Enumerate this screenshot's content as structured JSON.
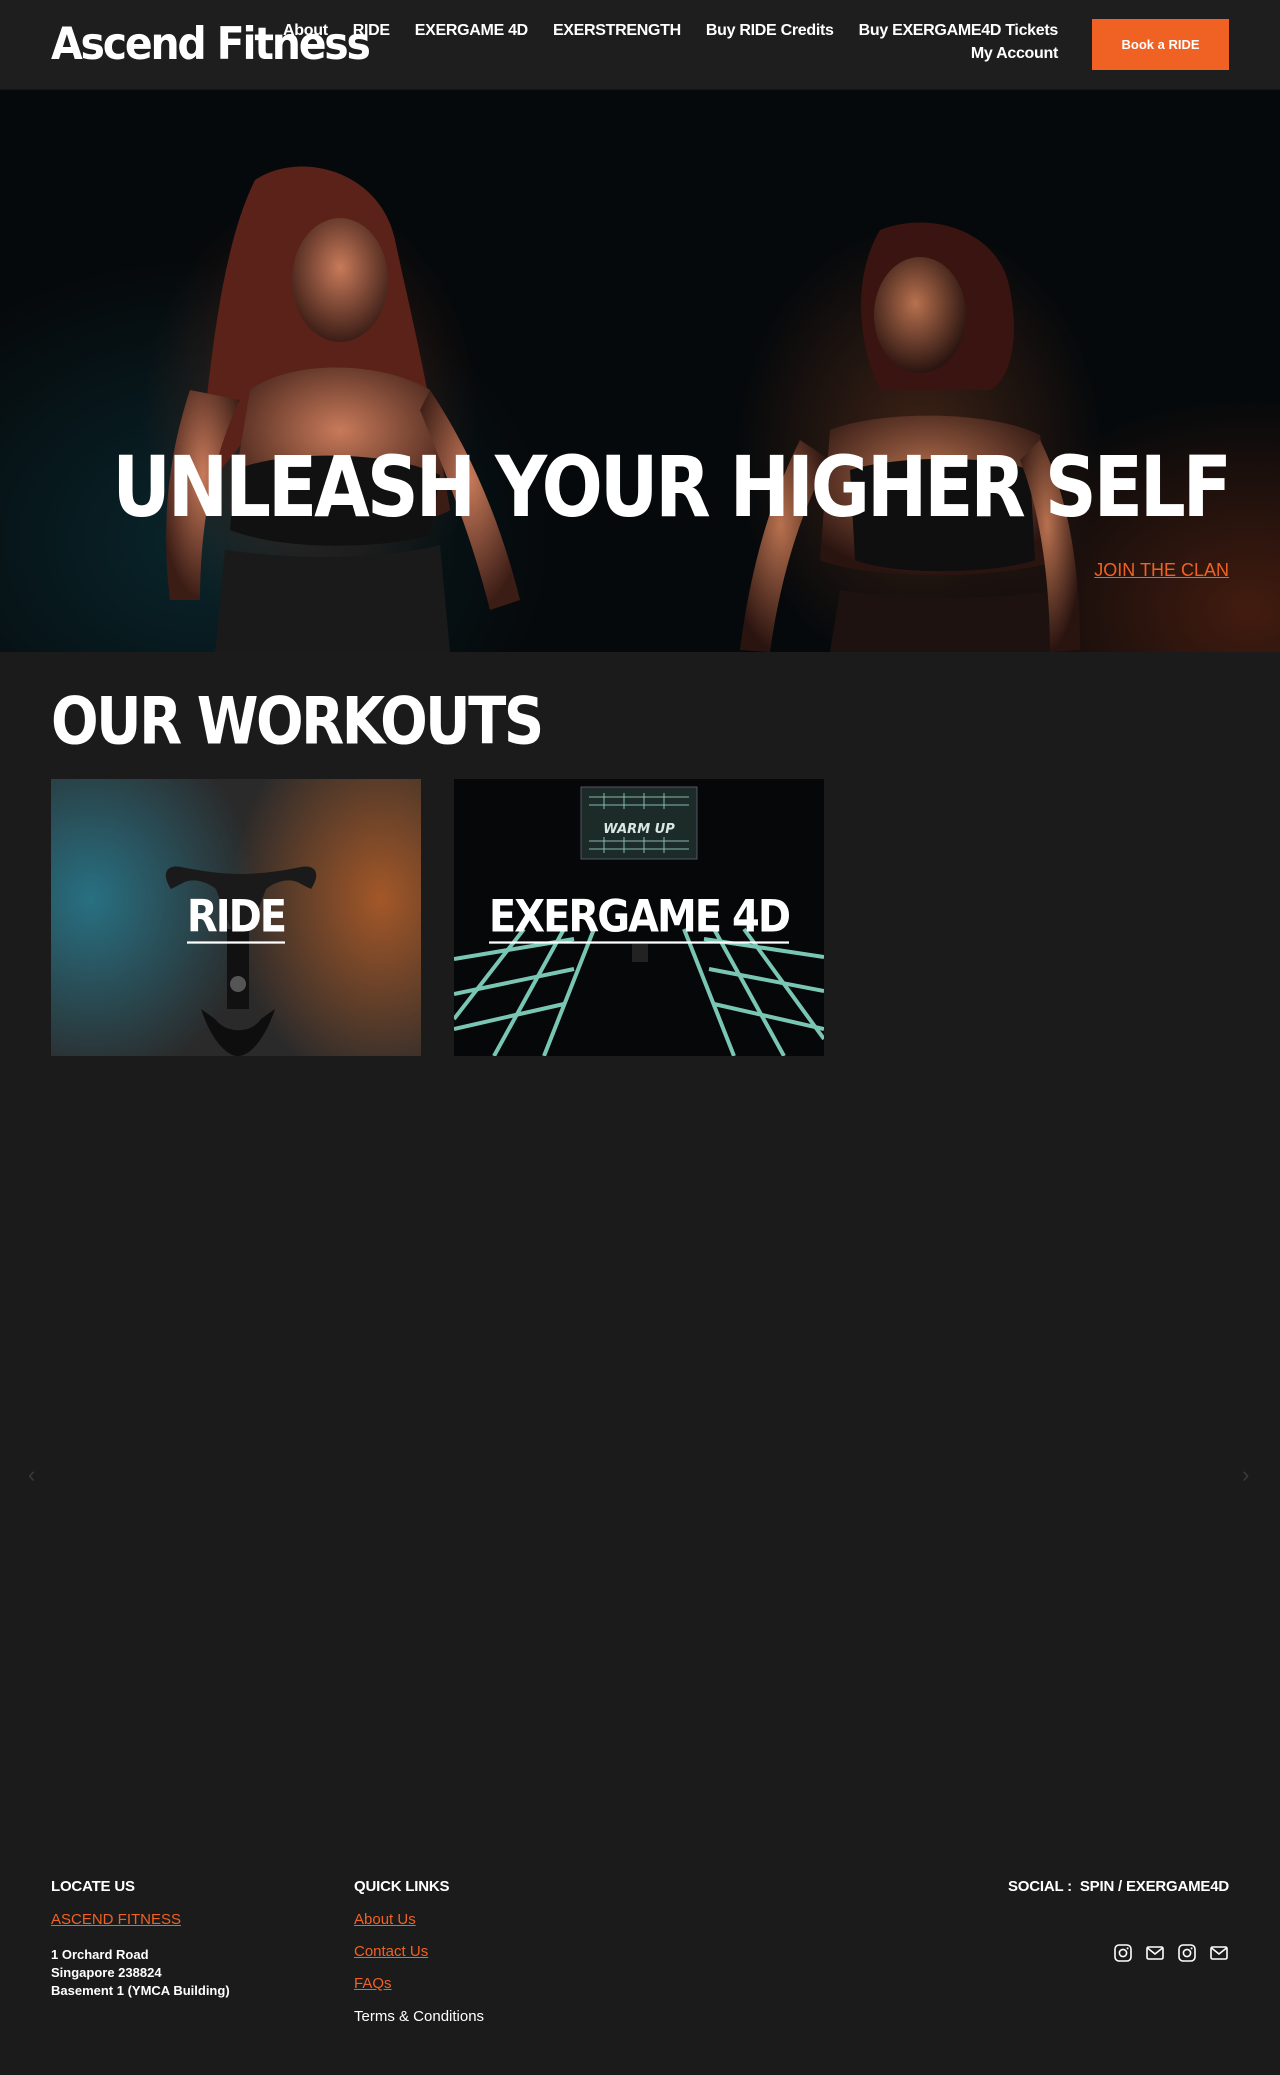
{
  "header": {
    "logo": "Ascend Fitness",
    "nav": [
      "About",
      "RIDE",
      "EXERGAME 4D",
      "EXERSTRENGTH",
      "Buy RIDE Credits",
      "Buy EXERGAME4D Tickets"
    ],
    "nav_account": "My Account",
    "book_button": "Book a RIDE"
  },
  "hero": {
    "title": "UNLEASH YOUR HIGHER SELF",
    "cta": "JOIN THE CLAN"
  },
  "workouts": {
    "title": "OUR WORKOUTS",
    "cards": [
      {
        "label": "RIDE"
      },
      {
        "label": "EXERGAME 4D",
        "screen_text": "WARM UP"
      }
    ],
    "prev_arrow": "‹",
    "next_arrow": "›"
  },
  "footer": {
    "locate_heading": "LOCATE US",
    "locate_link": "ASCEND FITNESS",
    "address": [
      "1 Orchard Road",
      "Singapore 238824",
      "Basement 1 (YMCA Building)"
    ],
    "quick_heading": "QUICK LINKS",
    "quick_links": [
      "About Us",
      "Contact Us",
      "FAQs"
    ],
    "terms": "Terms & Conditions",
    "social_heading": "SOCIAL :  SPIN / EXERGAME4D",
    "social_icons": [
      "instagram-icon",
      "mail-icon",
      "instagram-icon",
      "mail-icon"
    ]
  },
  "colors": {
    "accent": "#f06224",
    "background": "#1b1b1b",
    "header": "#1e1e1e"
  }
}
